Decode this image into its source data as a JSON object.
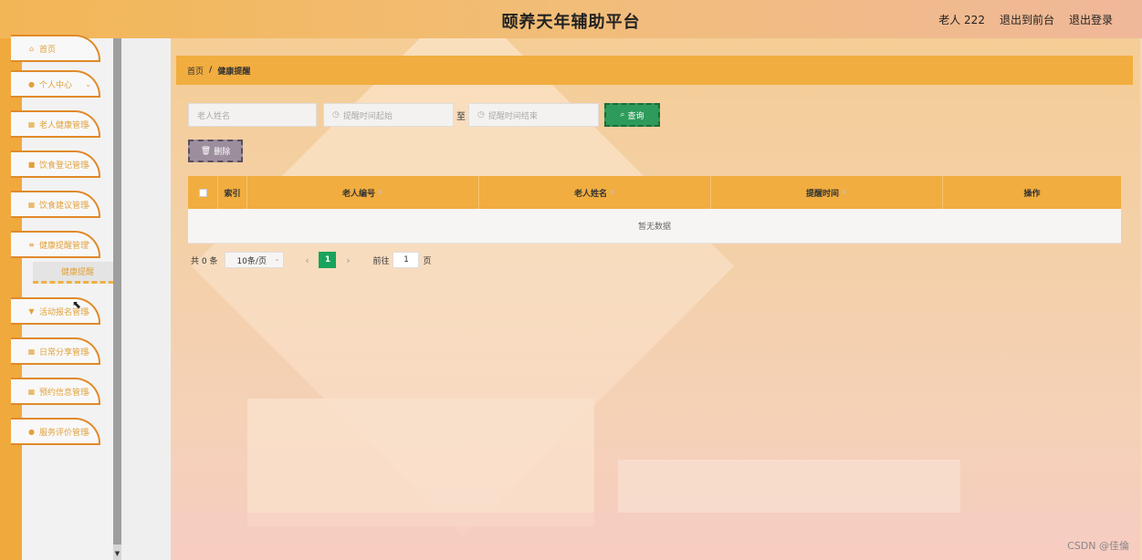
{
  "header": {
    "title": "颐养天年辅助平台",
    "user": "老人 222",
    "front_link": "退出到前台",
    "logout": "退出登录"
  },
  "sidebar": {
    "items": [
      {
        "label": "首页",
        "icon": "home-icon"
      },
      {
        "label": "个人中心",
        "icon": "user-icon"
      },
      {
        "label": "老人健康管理",
        "icon": "grid-icon"
      },
      {
        "label": "饮食登记管理",
        "icon": "bag-icon"
      },
      {
        "label": "饮食建议管理",
        "icon": "grid-icon"
      },
      {
        "label": "健康提醒管理",
        "icon": "list-icon"
      },
      {
        "label": "活动报名管理",
        "icon": "trophy-icon"
      },
      {
        "label": "日常分享管理",
        "icon": "grid-icon"
      },
      {
        "label": "预约信息管理",
        "icon": "grid-icon"
      },
      {
        "label": "服务评价管理",
        "icon": "location-icon"
      }
    ],
    "submenu_active": "健康提醒"
  },
  "breadcrumb": {
    "home": "首页",
    "separator": "/",
    "current": "健康提醒"
  },
  "search": {
    "name_placeholder": "老人姓名",
    "start_placeholder": "提醒时间起始",
    "to_label": "至",
    "end_placeholder": "提醒时间结束",
    "query_label": "查询"
  },
  "actions": {
    "delete_label": "删除"
  },
  "table": {
    "columns": [
      "索引",
      "老人编号",
      "老人姓名",
      "提醒时间",
      "操作"
    ],
    "empty_text": "暂无数据"
  },
  "pager": {
    "total": "共 0 条",
    "page_size": "10条/页",
    "current_page": "1",
    "goto_label": "前往",
    "goto_value": "1",
    "page_suffix": "页"
  },
  "watermark": "CSDN @佳倫",
  "colors": {
    "accent": "#f1ad3f",
    "menu_border": "#e08a2a",
    "query_button": "#2e9b5a",
    "delete_button": "#9d8e9d",
    "active_page": "#1aa35b"
  }
}
